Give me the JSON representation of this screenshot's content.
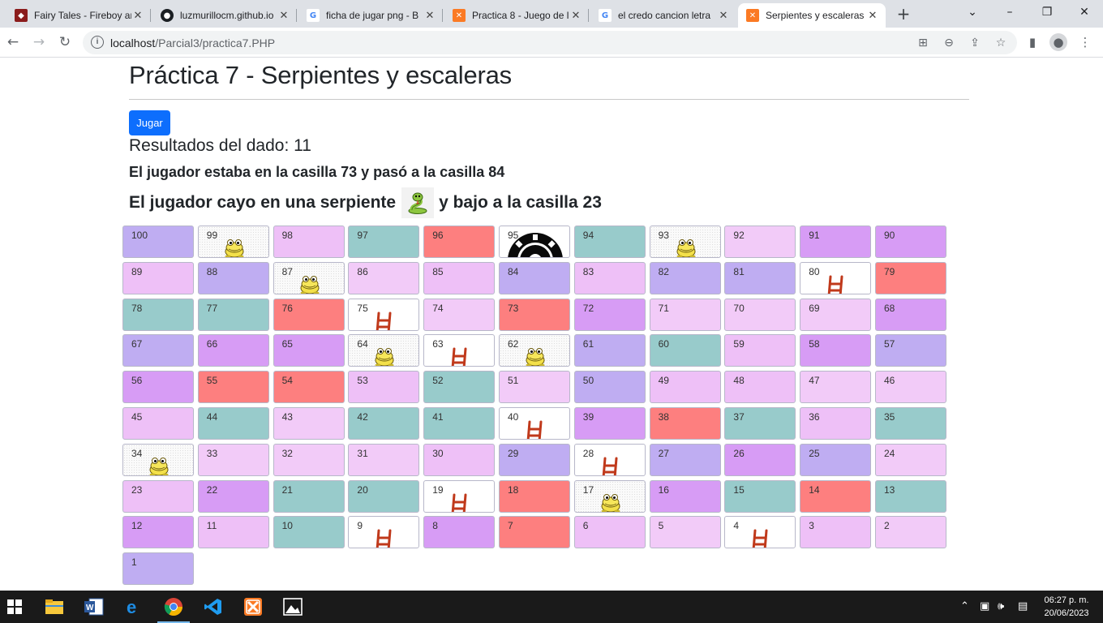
{
  "browser": {
    "tabs": [
      {
        "title": "Fairy Tales - Fireboy ar",
        "icon": "game-icon",
        "color": "#8b1c1c"
      },
      {
        "title": "luzmurillocm.github.io",
        "icon": "github-icon",
        "color": "#1b1f23"
      },
      {
        "title": "ficha de jugar png - B",
        "icon": "google-icon",
        "color": "#4285f4"
      },
      {
        "title": "Practica 8 - Juego de l",
        "icon": "xampp-icon",
        "color": "#fb7a24"
      },
      {
        "title": "el credo cancion letra",
        "icon": "google-icon",
        "color": "#4285f4"
      },
      {
        "title": "Serpientes y escaleras",
        "icon": "xampp-icon",
        "color": "#fb7a24",
        "active": true
      }
    ],
    "url_host": "localhost",
    "url_path": "/Parcial3/practica7.PHP"
  },
  "page": {
    "title": "Práctica 7 - Serpientes y escaleras",
    "play_button": "Jugar",
    "dice_result": "Resultados del dado: 11",
    "move_text": "El jugador estaba en la casilla 73 y pasó a la casilla 84",
    "snake_text_before": "El jugador cayo en una serpiente",
    "snake_text_after": "y bajo a la casilla 23"
  },
  "board": {
    "rows": [
      [
        [
          "100",
          "purple"
        ],
        [
          "99",
          "snake"
        ],
        [
          "98",
          "pink"
        ],
        [
          "97",
          "teal"
        ],
        [
          "96",
          "red"
        ],
        [
          "95",
          "token"
        ],
        [
          "94",
          "teal"
        ],
        [
          "93",
          "snake"
        ],
        [
          "92",
          "lpink"
        ],
        [
          "91",
          "violet"
        ],
        [
          "90",
          "violet"
        ]
      ],
      [
        [
          "89",
          "pink"
        ],
        [
          "88",
          "purple"
        ],
        [
          "87",
          "snake"
        ],
        [
          "86",
          "lpink"
        ],
        [
          "85",
          "pink"
        ],
        [
          "84",
          "purple"
        ],
        [
          "83",
          "pink"
        ],
        [
          "82",
          "purple"
        ],
        [
          "81",
          "purple"
        ],
        [
          "80",
          "ladder"
        ],
        [
          "79",
          "red"
        ]
      ],
      [
        [
          "78",
          "teal"
        ],
        [
          "77",
          "teal"
        ],
        [
          "76",
          "red"
        ],
        [
          "75",
          "ladder"
        ],
        [
          "74",
          "lpink"
        ],
        [
          "73",
          "red"
        ],
        [
          "72",
          "violet"
        ],
        [
          "71",
          "lpink"
        ],
        [
          "70",
          "lpink"
        ],
        [
          "69",
          "lpink"
        ],
        [
          "68",
          "violet"
        ]
      ],
      [
        [
          "67",
          "purple"
        ],
        [
          "66",
          "violet"
        ],
        [
          "65",
          "violet"
        ],
        [
          "64",
          "snake"
        ],
        [
          "63",
          "ladder"
        ],
        [
          "62",
          "snake"
        ],
        [
          "61",
          "purple"
        ],
        [
          "60",
          "teal"
        ],
        [
          "59",
          "pink"
        ],
        [
          "58",
          "violet"
        ],
        [
          "57",
          "purple"
        ]
      ],
      [
        [
          "56",
          "violet"
        ],
        [
          "55",
          "red"
        ],
        [
          "54",
          "red"
        ],
        [
          "53",
          "pink"
        ],
        [
          "52",
          "teal"
        ],
        [
          "51",
          "lpink"
        ],
        [
          "50",
          "purple"
        ],
        [
          "49",
          "pink"
        ],
        [
          "48",
          "pink"
        ],
        [
          "47",
          "lpink"
        ],
        [
          "46",
          "lpink"
        ]
      ],
      [
        [
          "45",
          "pink"
        ],
        [
          "44",
          "teal"
        ],
        [
          "43",
          "lpink"
        ],
        [
          "42",
          "teal"
        ],
        [
          "41",
          "teal"
        ],
        [
          "40",
          "ladder"
        ],
        [
          "39",
          "violet"
        ],
        [
          "38",
          "red"
        ],
        [
          "37",
          "teal"
        ],
        [
          "36",
          "pink"
        ],
        [
          "35",
          "teal"
        ]
      ],
      [
        [
          "34",
          "snake"
        ],
        [
          "33",
          "lpink"
        ],
        [
          "32",
          "lpink"
        ],
        [
          "31",
          "lpink"
        ],
        [
          "30",
          "pink"
        ],
        [
          "29",
          "purple"
        ],
        [
          "28",
          "ladder"
        ],
        [
          "27",
          "purple"
        ],
        [
          "26",
          "violet"
        ],
        [
          "25",
          "purple"
        ],
        [
          "24",
          "lpink"
        ]
      ],
      [
        [
          "23",
          "pink"
        ],
        [
          "22",
          "violet"
        ],
        [
          "21",
          "teal"
        ],
        [
          "20",
          "teal"
        ],
        [
          "19",
          "ladder"
        ],
        [
          "18",
          "red"
        ],
        [
          "17",
          "snake"
        ],
        [
          "16",
          "violet"
        ],
        [
          "15",
          "teal"
        ],
        [
          "14",
          "red"
        ],
        [
          "13",
          "teal"
        ]
      ],
      [
        [
          "12",
          "violet"
        ],
        [
          "11",
          "pink"
        ],
        [
          "10",
          "teal"
        ],
        [
          "9",
          "ladder"
        ],
        [
          "8",
          "violet"
        ],
        [
          "7",
          "red"
        ],
        [
          "6",
          "pink"
        ],
        [
          "5",
          "lpink"
        ],
        [
          "4",
          "ladder"
        ],
        [
          "3",
          "pink"
        ],
        [
          "2",
          "lpink"
        ]
      ],
      [
        [
          "1",
          "purple"
        ]
      ]
    ]
  },
  "taskbar": {
    "apps": [
      "windows-start-icon",
      "file-explorer-icon",
      "word-icon",
      "edge-icon",
      "chrome-icon",
      "vscode-icon",
      "xampp-icon",
      "photos-icon"
    ],
    "time": "06:27 p. m.",
    "date": "20/06/2023"
  }
}
